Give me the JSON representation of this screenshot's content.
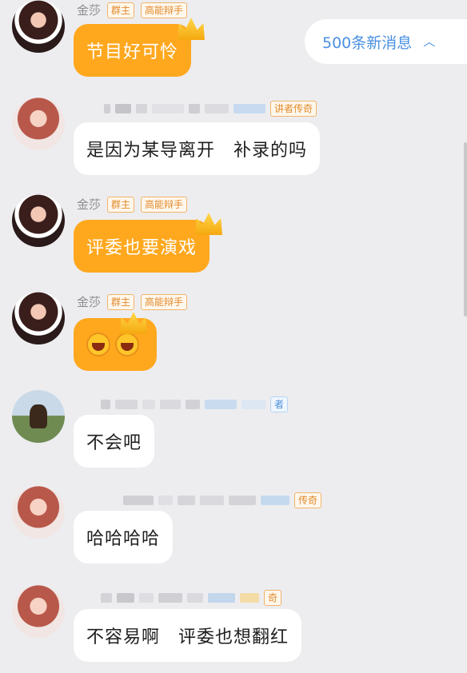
{
  "banner": {
    "new_messages": "500条新消息",
    "chevron": "chevron-up-icon"
  },
  "messages": [
    {
      "sender": "金莎",
      "badge_owner": "群主",
      "badge_title": "高能辩手",
      "text": "节目好可怜"
    },
    {
      "badge": "讲者传奇",
      "text": "是因为某导离开　补录的吗"
    },
    {
      "sender": "金莎",
      "badge_owner": "群主",
      "badge_title": "高能辩手",
      "text": "评委也要演戏"
    },
    {
      "sender": "金莎",
      "badge_owner": "群主",
      "badge_title": "高能辩手",
      "emoji": "laughing-emoji"
    },
    {
      "badge": "者",
      "text": "不会吧"
    },
    {
      "badge": "传奇",
      "text": "哈哈哈哈"
    },
    {
      "badge": "奇",
      "text": "不容易啊　评委也想翻红"
    }
  ]
}
